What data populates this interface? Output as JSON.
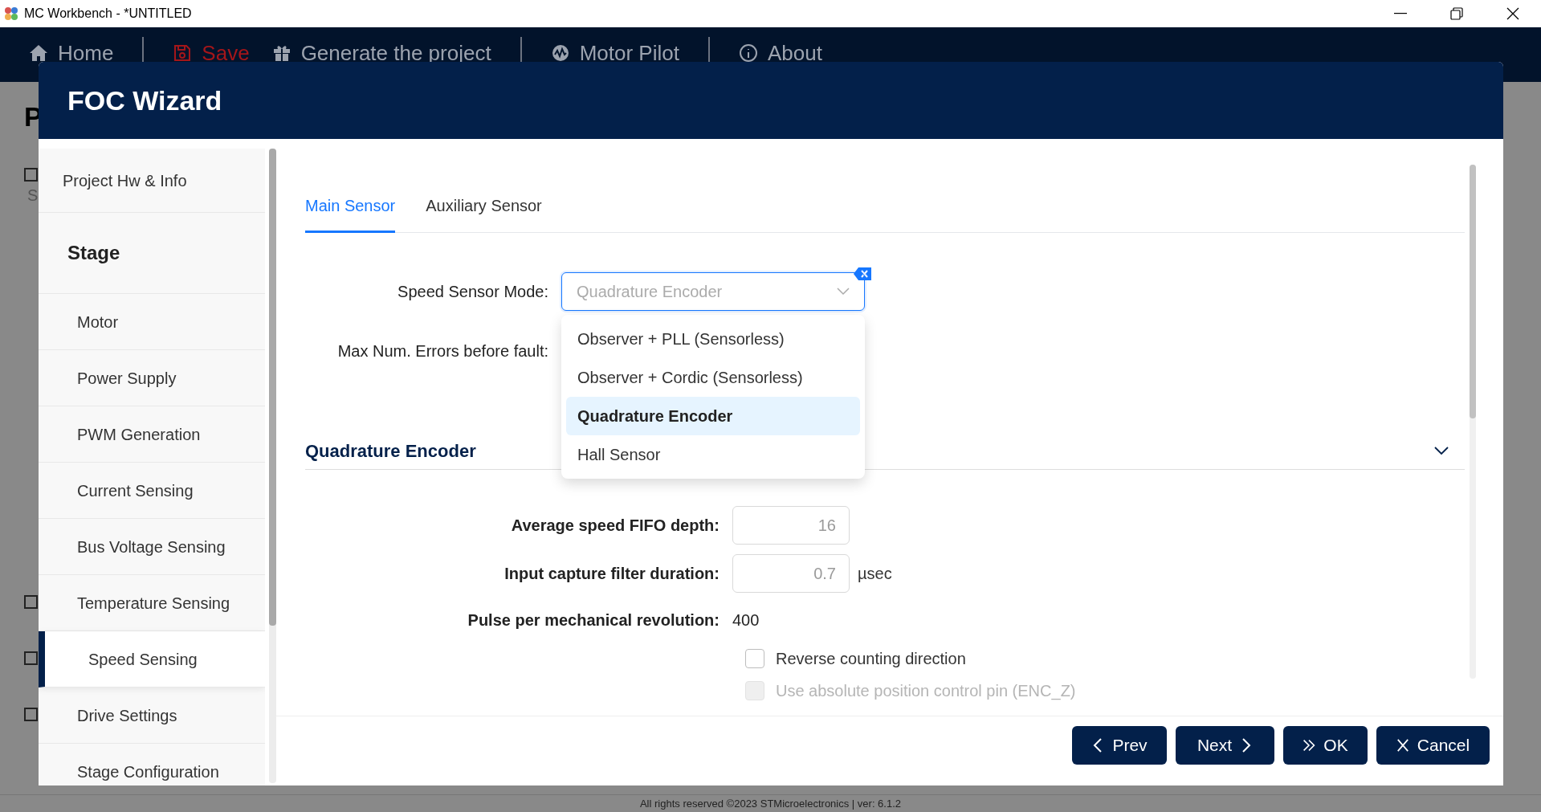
{
  "window": {
    "title": "MC Workbench - *UNTITLED"
  },
  "nav": [
    {
      "label": "Home",
      "color": "#9ca3af"
    },
    {
      "label": "Save",
      "color": "#a4161a"
    },
    {
      "label": "Generate the project",
      "color": "#9ca3af"
    },
    {
      "label": "Motor Pilot",
      "color": "#9ca3af"
    },
    {
      "label": "About",
      "color": "#9ca3af"
    }
  ],
  "background": {
    "heading": "P",
    "label": "S",
    "checkboxes": [
      {
        "checked": false
      },
      {
        "checked": false
      },
      {
        "checked": false
      },
      {
        "checked": false
      }
    ]
  },
  "footer": "All rights reserved ©2023 STMicroelectronics | ver: 6.1.2",
  "dialog": {
    "title": "FOC Wizard",
    "sidebar": [
      {
        "label": "Project Hw & Info",
        "kind": "item",
        "selected": false
      },
      {
        "label": "Stage",
        "kind": "heading"
      },
      {
        "label": "Motor",
        "kind": "subitem",
        "selected": false
      },
      {
        "label": "Power Supply",
        "kind": "subitem",
        "selected": false
      },
      {
        "label": "PWM Generation",
        "kind": "subitem",
        "selected": false
      },
      {
        "label": "Current Sensing",
        "kind": "subitem",
        "selected": false
      },
      {
        "label": "Bus Voltage Sensing",
        "kind": "subitem",
        "selected": false
      },
      {
        "label": "Temperature Sensing",
        "kind": "subitem",
        "selected": false
      },
      {
        "label": "Speed Sensing",
        "kind": "subitem",
        "selected": true
      },
      {
        "label": "Drive Settings",
        "kind": "subitem",
        "selected": false
      },
      {
        "label": "Stage Configuration",
        "kind": "subitem",
        "selected": false
      }
    ],
    "tabs": [
      {
        "label": "Main Sensor",
        "selected": true
      },
      {
        "label": "Auxiliary Sensor",
        "selected": false
      }
    ],
    "speed_sensor_mode": {
      "label": "Speed Sensor Mode:",
      "value": "Quadrature Encoder",
      "expanded": true,
      "options": [
        {
          "label": "Observer + PLL (Sensorless)",
          "selected": false
        },
        {
          "label": "Observer + Cordic (Sensorless)",
          "selected": false
        },
        {
          "label": "Quadrature Encoder",
          "selected": true
        },
        {
          "label": "Hall Sensor",
          "selected": false
        }
      ]
    },
    "max_errors": {
      "label": "Max Num. Errors before fault:"
    },
    "section": {
      "title": "Quadrature Encoder",
      "expanded": true
    },
    "fields": [
      {
        "kind": "input",
        "label": "Average speed FIFO depth:",
        "value": "16"
      },
      {
        "kind": "input",
        "label": "Input capture filter duration:",
        "value": "0.7",
        "unit": "µsec"
      },
      {
        "kind": "text",
        "label": "Pulse per mechanical revolution:",
        "value": "400"
      },
      {
        "kind": "checkbox",
        "label": "Reverse counting direction",
        "checked": false,
        "disabled": false
      },
      {
        "kind": "checkbox",
        "label": "Use absolute position control pin (ENC_Z)",
        "checked": false,
        "disabled": true
      }
    ],
    "buttons": [
      {
        "label": "Prev"
      },
      {
        "label": "Next"
      },
      {
        "label": "OK"
      },
      {
        "label": "Cancel"
      }
    ]
  }
}
